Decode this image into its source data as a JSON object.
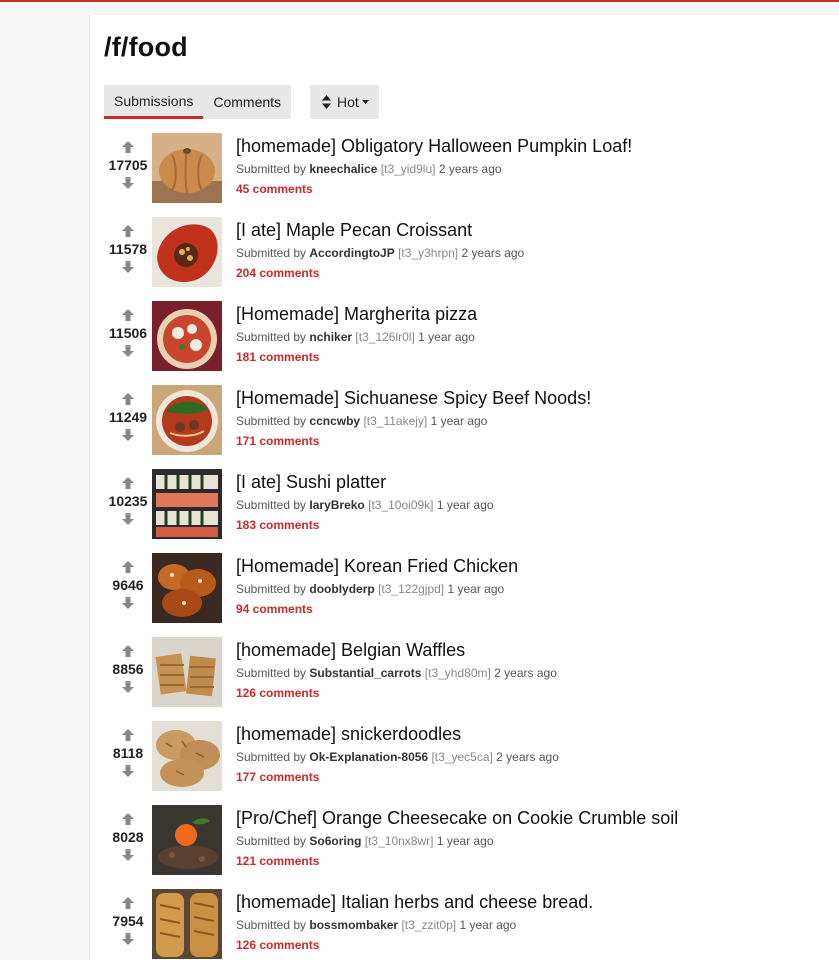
{
  "subforum": {
    "title": "/f/food"
  },
  "tabs": [
    {
      "label": "Submissions",
      "active": true
    },
    {
      "label": "Comments",
      "active": false
    }
  ],
  "sort": {
    "label": "Hot"
  },
  "colors": {
    "accent": "#cc2a2a",
    "tab_bg": "#e7e7e7"
  },
  "meta_labels": {
    "submitted_by": "Submitted by"
  },
  "posts": [
    {
      "score": "17705",
      "title": "[homemade] Obligatory Halloween Pumpkin Loaf!",
      "user": "kneechalice",
      "id": "[t3_yid9lu]",
      "age": "2 years ago",
      "comments": "45 comments"
    },
    {
      "score": "11578",
      "title": "[I ate] Maple Pecan Croissant",
      "user": "AccordingtoJP",
      "id": "[t3_y3hrpn]",
      "age": "2 years ago",
      "comments": "204 comments"
    },
    {
      "score": "11506",
      "title": "[Homemade] Margherita pizza",
      "user": "nchiker",
      "id": "[t3_126lr0l]",
      "age": "1 year ago",
      "comments": "181 comments"
    },
    {
      "score": "11249",
      "title": "[Homemade] Sichuanese Spicy Beef Noods!",
      "user": "ccncwby",
      "id": "[t3_11akejy]",
      "age": "1 year ago",
      "comments": "171 comments"
    },
    {
      "score": "10235",
      "title": "[I ate] Sushi platter",
      "user": "IaryBreko",
      "id": "[t3_10oi09k]",
      "age": "1 year ago",
      "comments": "183 comments"
    },
    {
      "score": "9646",
      "title": "[Homemade] Korean Fried Chicken",
      "user": "doobIyderp",
      "id": "[t3_122gjpd]",
      "age": "1 year ago",
      "comments": "94 comments"
    },
    {
      "score": "8856",
      "title": "[homemade] Belgian Waffles",
      "user": "Substantial_carrots",
      "id": "[t3_yhd80m]",
      "age": "2 years ago",
      "comments": "126 comments"
    },
    {
      "score": "8118",
      "title": "[homemade] snickerdoodles",
      "user": "Ok-Explanation-8056",
      "id": "[t3_yec5ca]",
      "age": "2 years ago",
      "comments": "177 comments"
    },
    {
      "score": "8028",
      "title": "[Pro/Chef] Orange Cheesecake on Cookie Crumble soil",
      "user": "So6oring",
      "id": "[t3_10nx8wr]",
      "age": "1 year ago",
      "comments": "121 comments"
    },
    {
      "score": "7954",
      "title": "[homemade] Italian herbs and cheese bread.",
      "user": "bossmombaker",
      "id": "[t3_zzit0p]",
      "age": "1 year ago",
      "comments": "126 comments"
    }
  ]
}
